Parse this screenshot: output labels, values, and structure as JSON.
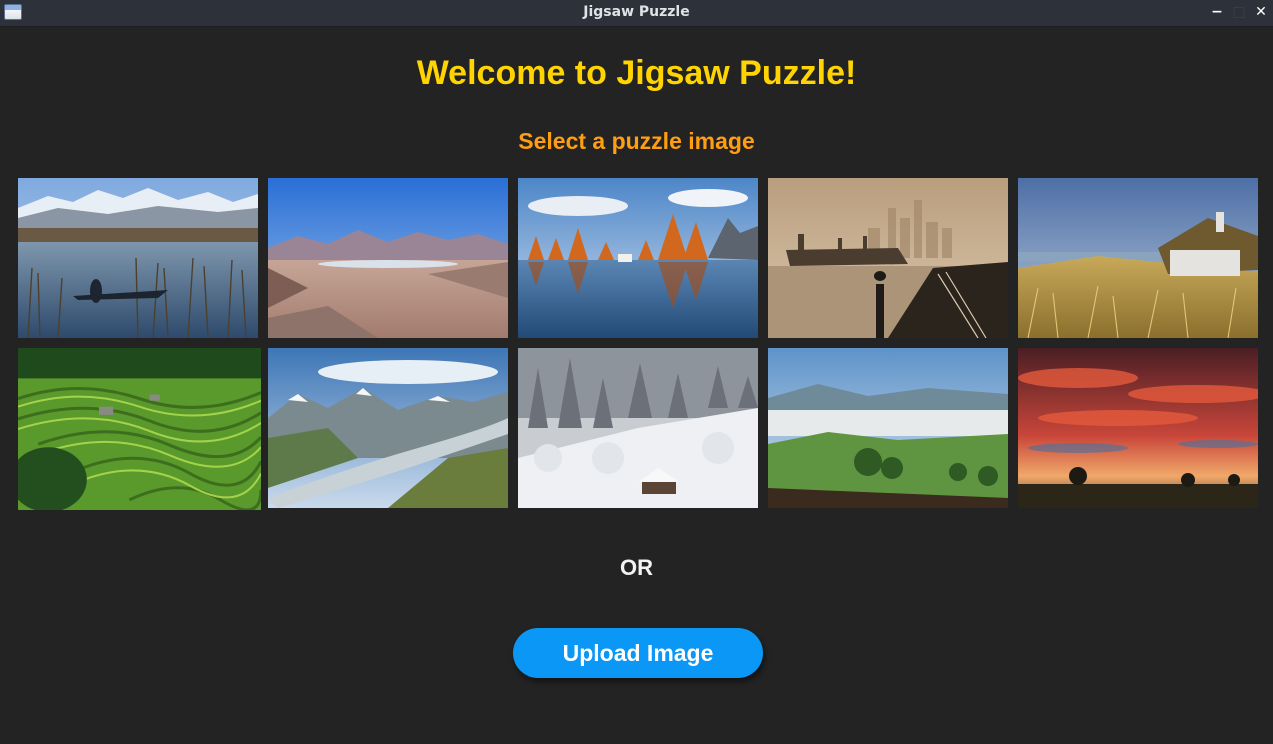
{
  "window": {
    "title": "Jigsaw Puzzle",
    "minimize_label": "−",
    "maximize_label": "□",
    "close_label": "✕"
  },
  "main": {
    "heading": "Welcome to Jigsaw Puzzle!",
    "subheading": "Select a puzzle image",
    "separator": "OR",
    "upload_label": "Upload Image"
  },
  "colors": {
    "background": "#232323",
    "heading": "#ffd400",
    "subheading": "#ff9e12",
    "button": "#0a97f5"
  },
  "thumbnails": [
    {
      "name": "lake-reeds-mountains"
    },
    {
      "name": "desert-valley"
    },
    {
      "name": "autumn-lake-reflection"
    },
    {
      "name": "foggy-harbor-skyline"
    },
    {
      "name": "thatched-cottage-dunes"
    },
    {
      "name": "rice-terraces"
    },
    {
      "name": "glacier-valley"
    },
    {
      "name": "snowy-forest-cabin"
    },
    {
      "name": "misty-green-valley"
    },
    {
      "name": "red-sunset-sky"
    }
  ]
}
